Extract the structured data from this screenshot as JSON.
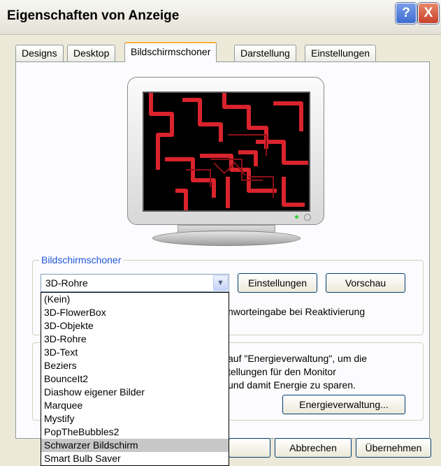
{
  "window": {
    "title": "Eigenschaften von Anzeige",
    "help_label": "?",
    "close_label": "X"
  },
  "tabs": [
    {
      "label": "Designs",
      "active": false
    },
    {
      "label": "Desktop",
      "active": false
    },
    {
      "label": "Bildschirmschoner",
      "active": true
    },
    {
      "label": "Darstellung",
      "active": false
    },
    {
      "label": "Einstellungen",
      "active": false
    }
  ],
  "screensaver": {
    "group_label": "Bildschirmschoner",
    "selected_value": "3D-Rohre",
    "settings_button": "Einstellungen",
    "preview_button": "Vorschau",
    "password_text": "nworteingabe bei Reaktivierung",
    "options": [
      "(Kein)",
      "3D-FlowerBox",
      "3D-Objekte",
      "3D-Rohre",
      "3D-Text",
      "Beziers",
      "BounceIt2",
      "Diashow eigener Bilder",
      "Marquee",
      "Mystify",
      "PopTheBubbles2",
      "Schwarzer Bildschirm",
      "Smart Bulb Saver"
    ],
    "highlighted_option": "Schwarzer Bildschirm"
  },
  "energy": {
    "line1": "auf \"Energieverwaltung\", um die",
    "line2": "tellungen für den Monitor",
    "line3": "und damit Energie zu sparen.",
    "button": "Energieverwaltung..."
  },
  "footer": {
    "cancel": "Abbrechen",
    "apply": "Übernehmen"
  },
  "colors": {
    "pipes": "#e0202a",
    "group_label": "#2156d8",
    "tab_highlight": "#f4b13c"
  }
}
